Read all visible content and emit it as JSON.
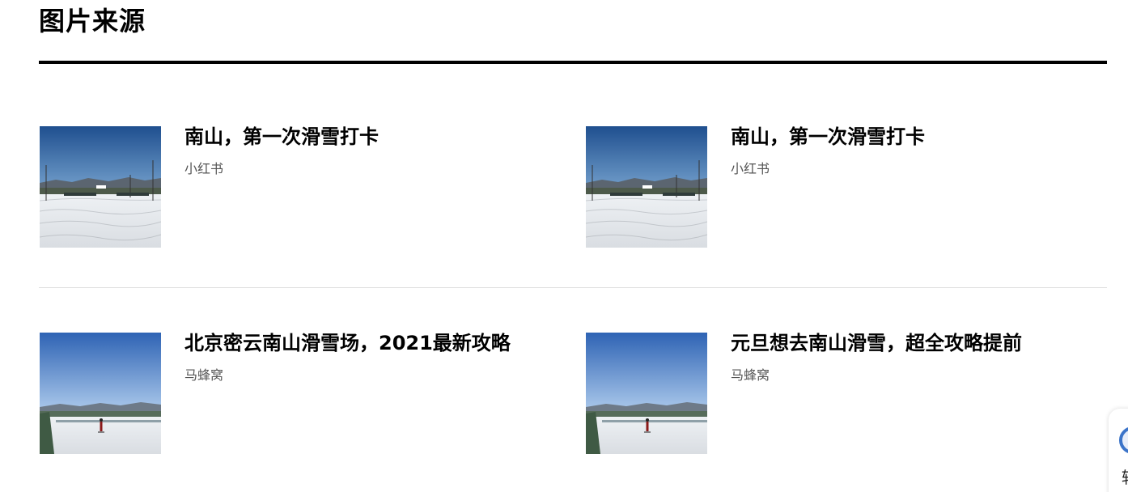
{
  "section": {
    "title": "图片来源"
  },
  "cards": [
    {
      "title": "南山，第一次滑雪打卡",
      "source": "小红书",
      "thumb_scene": "ski-slope-wide"
    },
    {
      "title": "南山，第一次滑雪打卡",
      "source": "小红书",
      "thumb_scene": "ski-slope-wide"
    },
    {
      "title": "北京密云南山滑雪场，2021最新攻略",
      "source": "马蜂窝",
      "thumb_scene": "ski-slope-skier"
    },
    {
      "title": "元旦想去南山滑雪，超全攻略提前",
      "source": "马蜂窝",
      "thumb_scene": "ski-slope-skier"
    }
  ],
  "floating_widget": {
    "label": "辅"
  },
  "colors": {
    "rule": "#000000",
    "divider": "#dedede",
    "source_text": "#555555",
    "widget_ring": "#3b74c9"
  }
}
